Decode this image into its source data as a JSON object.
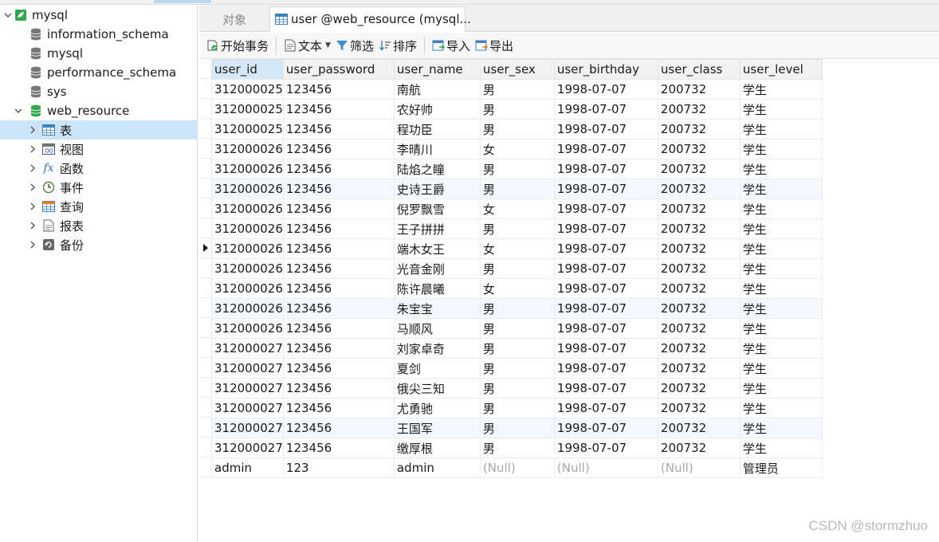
{
  "sidebar": {
    "connection": {
      "label": "mysql",
      "expanded": true,
      "icon": "connection-leaf-icon"
    },
    "databases": [
      {
        "label": "information_schema",
        "icon": "database-icon",
        "color": "#777777"
      },
      {
        "label": "mysql",
        "icon": "database-icon",
        "color": "#777777"
      },
      {
        "label": "performance_schema",
        "icon": "database-icon",
        "color": "#777777"
      },
      {
        "label": "sys",
        "icon": "database-icon",
        "color": "#777777"
      },
      {
        "label": "web_resource",
        "icon": "database-icon",
        "color": "#2fa84f",
        "expanded": true
      }
    ],
    "categories": [
      {
        "label": "表",
        "icon": "table-icon",
        "selected": true
      },
      {
        "label": "视图",
        "icon": "view-icon"
      },
      {
        "label": "函数",
        "icon": "function-icon"
      },
      {
        "label": "事件",
        "icon": "event-clock-icon"
      },
      {
        "label": "查询",
        "icon": "query-icon"
      },
      {
        "label": "报表",
        "icon": "report-icon"
      },
      {
        "label": "备份",
        "icon": "backup-icon"
      }
    ]
  },
  "tabs": {
    "objects": "对象",
    "active": "user @web_resource (mysql..."
  },
  "toolbar": {
    "begin_transaction": "开始事务",
    "text": "文本",
    "filter": "筛选",
    "sort": "排序",
    "import": "导入",
    "export": "导出"
  },
  "grid": {
    "columns": [
      "user_id",
      "user_password",
      "user_name",
      "user_sex",
      "user_birthday",
      "user_class",
      "user_level"
    ],
    "current_row": 8,
    "rows": [
      [
        "312000025",
        "123456",
        "南航",
        "男",
        "1998-07-07",
        "200732",
        "学生"
      ],
      [
        "312000025",
        "123456",
        "农好帅",
        "男",
        "1998-07-07",
        "200732",
        "学生"
      ],
      [
        "312000025",
        "123456",
        "程功臣",
        "男",
        "1998-07-07",
        "200732",
        "学生"
      ],
      [
        "312000026",
        "123456",
        "李晴川",
        "女",
        "1998-07-07",
        "200732",
        "学生"
      ],
      [
        "312000026",
        "123456",
        "陆焰之瞳",
        "男",
        "1998-07-07",
        "200732",
        "学生"
      ],
      [
        "312000026",
        "123456",
        "史诗王爵",
        "男",
        "1998-07-07",
        "200732",
        "学生"
      ],
      [
        "312000026",
        "123456",
        "倪罗飘雪",
        "女",
        "1998-07-07",
        "200732",
        "学生"
      ],
      [
        "312000026",
        "123456",
        "王子拼拼",
        "男",
        "1998-07-07",
        "200732",
        "学生"
      ],
      [
        "312000026",
        "123456",
        "端木女王",
        "女",
        "1998-07-07",
        "200732",
        "学生"
      ],
      [
        "312000026",
        "123456",
        "光音金刚",
        "男",
        "1998-07-07",
        "200732",
        "学生"
      ],
      [
        "312000026",
        "123456",
        "陈许晨曦",
        "女",
        "1998-07-07",
        "200732",
        "学生"
      ],
      [
        "312000026",
        "123456",
        "朱宝宝",
        "男",
        "1998-07-07",
        "200732",
        "学生"
      ],
      [
        "312000026",
        "123456",
        "马顺风",
        "男",
        "1998-07-07",
        "200732",
        "学生"
      ],
      [
        "312000027",
        "123456",
        "刘家卓奇",
        "男",
        "1998-07-07",
        "200732",
        "学生"
      ],
      [
        "312000027",
        "123456",
        "夏剑",
        "男",
        "1998-07-07",
        "200732",
        "学生"
      ],
      [
        "312000027",
        "123456",
        "俄尖三知",
        "男",
        "1998-07-07",
        "200732",
        "学生"
      ],
      [
        "312000027",
        "123456",
        "尤勇驰",
        "男",
        "1998-07-07",
        "200732",
        "学生"
      ],
      [
        "312000027",
        "123456",
        "王国军",
        "男",
        "1998-07-07",
        "200732",
        "学生"
      ],
      [
        "312000027",
        "123456",
        "缴厚根",
        "男",
        "1998-07-07",
        "200732",
        "学生"
      ],
      [
        "admin",
        "123",
        "admin",
        "(Null)",
        "(Null)",
        "(Null)",
        "管理员"
      ]
    ]
  },
  "watermark": "CSDN @stormzhuo",
  "colors": {
    "selection": "#cce4f7",
    "header_first": "#d6e7f7",
    "alt_row": "#f4f9ff",
    "null_text": "#a8a8a8",
    "active_db": "#2fa84f"
  }
}
